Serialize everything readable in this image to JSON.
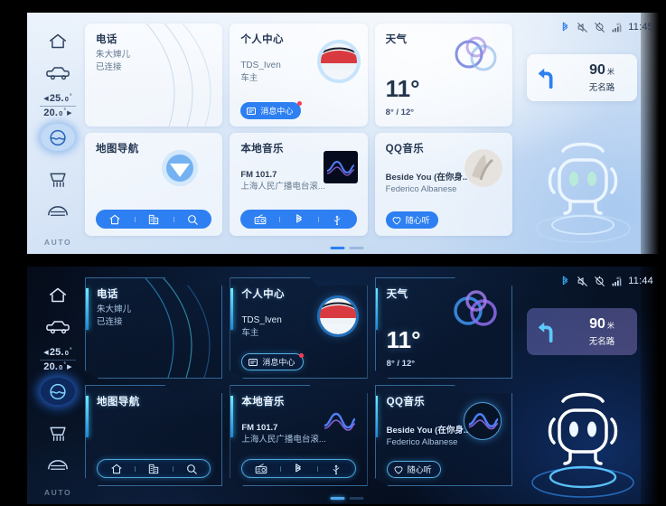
{
  "screen": {
    "panels": [
      {
        "id": "light",
        "theme": "light",
        "time": "11:45"
      },
      {
        "id": "dark",
        "theme": "dark",
        "time": "11:44"
      }
    ]
  },
  "statusbar": {
    "time_light": "11:45",
    "time_dark": "11:44",
    "icons": [
      "bluetooth-icon",
      "mute-icon",
      "location-off-icon",
      "signal-4g-icon"
    ],
    "network_label": "4G"
  },
  "sidebar": {
    "items": [
      {
        "name": "home-icon",
        "label": "主页"
      },
      {
        "name": "car-icon",
        "label": "车辆"
      },
      {
        "name": "ac-fan-icon",
        "label": "空调",
        "active": true
      },
      {
        "name": "defrost-front-icon",
        "label": "前除霜"
      },
      {
        "name": "defrost-rear-icon",
        "label": "后除霜"
      }
    ],
    "temp_left": "25.",
    "temp_left_dec": "0",
    "temp_right": "20.",
    "temp_right_dec": "0",
    "degree": "°",
    "arrow_left": "◀",
    "arrow_right": "▶",
    "auto_label": "AUTO"
  },
  "cards": {
    "phone": {
      "title": "电话",
      "line1": "朱大婶儿",
      "line2": "已连接"
    },
    "profile": {
      "title": "个人中心",
      "line1": "TDS_Iven",
      "line2": "车主",
      "button": "消息中心",
      "button_icon": "message-icon",
      "badge": true
    },
    "weather": {
      "title": "天气",
      "temp": "11°",
      "range": "8° / 12°",
      "icon": "cloudy-icon"
    },
    "map": {
      "title": "地图导航",
      "buttons": [
        {
          "icon": "home-icon",
          "label": "回家"
        },
        {
          "icon": "office-icon",
          "label": "去公司"
        },
        {
          "icon": "search-icon",
          "label": "搜索"
        }
      ]
    },
    "radio": {
      "title": "本地音乐",
      "line1": "FM 101.7",
      "line2": "上海人民广播电台滚...",
      "buttons": [
        {
          "icon": "radio-icon",
          "label": "收音机"
        },
        {
          "icon": "bluetooth-icon",
          "label": "蓝牙"
        },
        {
          "icon": "usb-icon",
          "label": "USB"
        }
      ]
    },
    "qqmusic": {
      "title": "QQ音乐",
      "line1": "Beside You (在你身..",
      "line2": "Federico Albanese",
      "button": "随心听",
      "button_icon": "heart-icon"
    }
  },
  "navigation": {
    "distance": "90",
    "unit": "米",
    "road": "无名路",
    "maneuver": "turn-left-icon"
  },
  "assistant": {
    "name": "robot-assistant",
    "state": "idle"
  },
  "pager": {
    "total": 2,
    "active": 1
  },
  "colors": {
    "accent_blue": "#2d7ff2",
    "dark_accent": "#4ea8ef",
    "cyan_bar": "#6feaff",
    "badge_red": "#ff3b4e",
    "light_bg": "#dde9f8",
    "dark_bg": "#061022"
  }
}
